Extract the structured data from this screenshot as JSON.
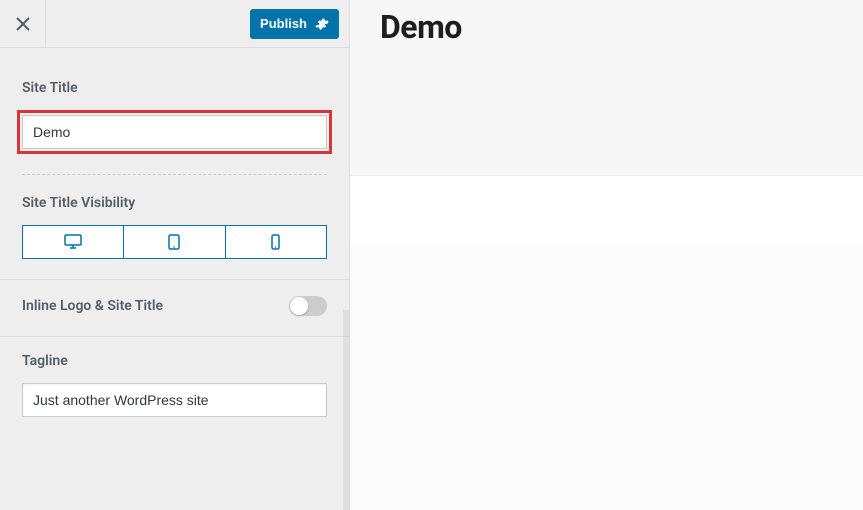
{
  "topbar": {
    "publish_label": "Publish"
  },
  "site_title": {
    "label": "Site Title",
    "value": "Demo"
  },
  "visibility": {
    "label": "Site Title Visibility"
  },
  "inline_logo": {
    "label": "Inline Logo & Site Title",
    "enabled": false
  },
  "tagline": {
    "label": "Tagline",
    "value": "Just another WordPress site"
  },
  "preview": {
    "site_title": "Demo"
  }
}
